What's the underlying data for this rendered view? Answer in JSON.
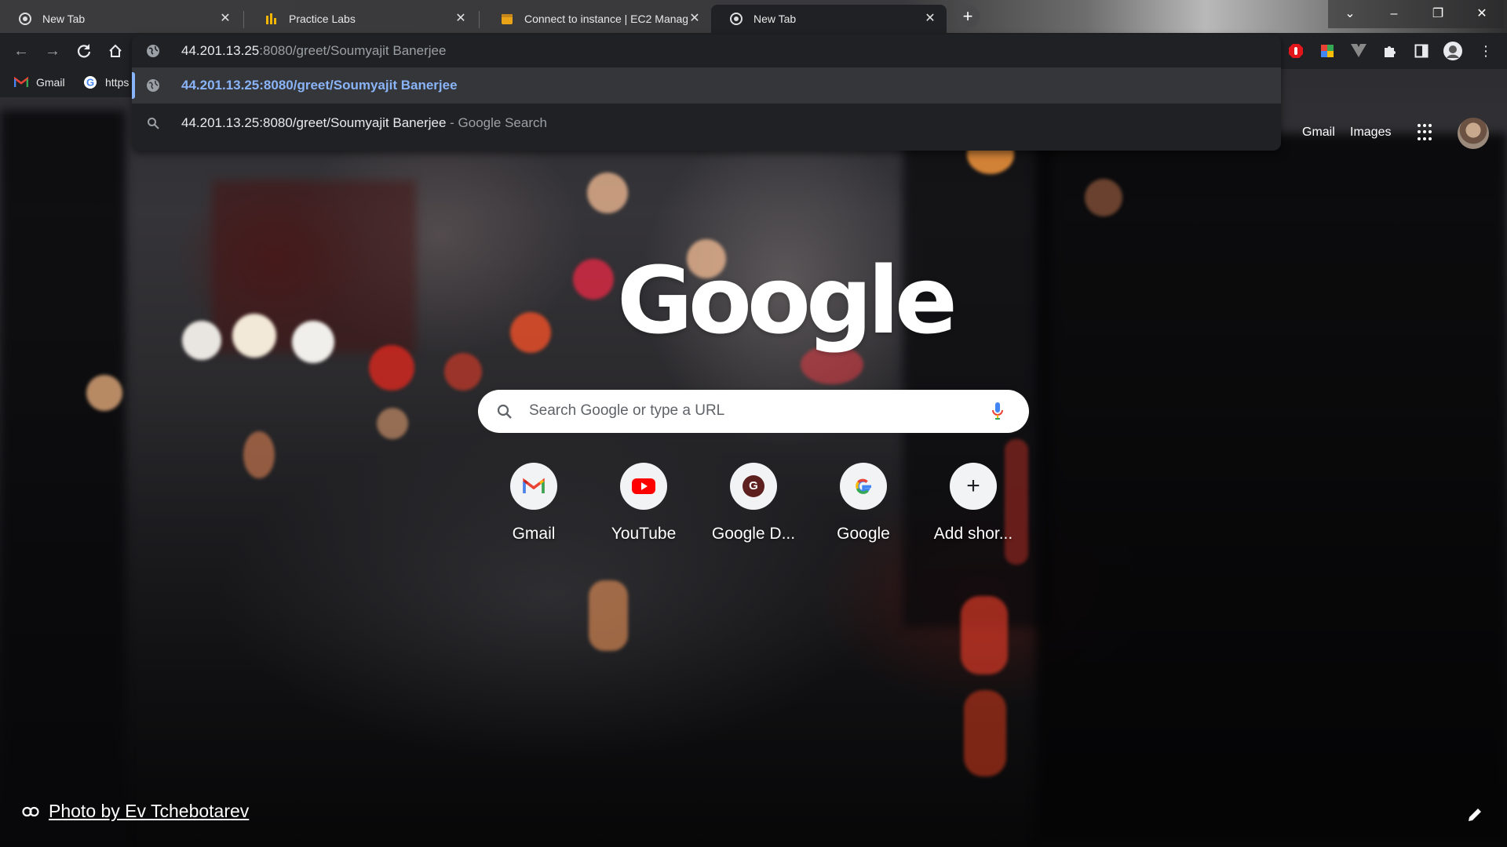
{
  "browser": {
    "tabs": [
      {
        "title": "New Tab",
        "icon": "chrome-icon"
      },
      {
        "title": "Practice Labs",
        "icon": "practice-labs-icon"
      },
      {
        "title": "Connect to instance | EC2 Manag",
        "icon": "aws-icon"
      },
      {
        "title": "New Tab",
        "icon": "chrome-icon",
        "active": true
      }
    ],
    "new_tab_symbol": "+",
    "window_controls": [
      "⌄",
      "–",
      "❐",
      "✕"
    ]
  },
  "bookmarks": [
    {
      "label": "Gmail",
      "icon": "gmail-icon"
    },
    {
      "label": "https",
      "icon": "google-icon"
    }
  ],
  "omnibox": {
    "input_main": "44.201.13.25",
    "input_rest": ":8080/greet/Soumyajit Banerjee",
    "suggestions": [
      {
        "type": "url",
        "text": "44.201.13.25:8080/greet/Soumyajit Banerjee",
        "selected": true
      },
      {
        "type": "search",
        "text": "44.201.13.25:8080/greet/Soumyajit Banerjee",
        "suffix": " - Google Search"
      }
    ]
  },
  "header_links": {
    "gmail": "Gmail",
    "images": "Images"
  },
  "logo_text": "Google",
  "search": {
    "placeholder": "Search Google or type a URL"
  },
  "shortcuts": [
    {
      "label": "Gmail",
      "icon": "gmail-icon"
    },
    {
      "label": "YouTube",
      "icon": "youtube-icon"
    },
    {
      "label": "Google D...",
      "icon": "g-letter-icon",
      "letter": "G"
    },
    {
      "label": "Google",
      "icon": "google-icon"
    },
    {
      "label": "Add shor...",
      "icon": "plus-icon",
      "symbol": "+"
    }
  ],
  "footer": {
    "attribution": "Photo by Ev Tchebotarev"
  },
  "colors": {
    "accent_link": "#8ab4f8",
    "toolbar_bg": "#202124",
    "youtube_red": "#ff0000",
    "dark_red_shortcut": "#5e1f1f"
  }
}
